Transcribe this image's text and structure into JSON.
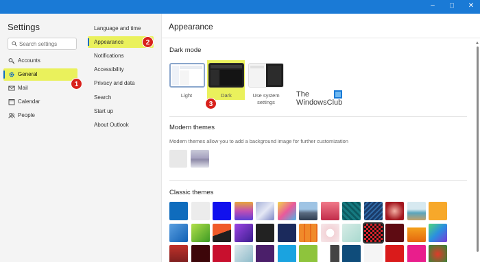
{
  "window": {
    "controls": [
      "minimize",
      "maximize",
      "close"
    ],
    "titlebar_color": "#1a7ad6"
  },
  "left_nav": {
    "title": "Settings",
    "search_placeholder": "Search settings",
    "items": [
      {
        "label": "Accounts",
        "icon": "key-icon"
      },
      {
        "label": "General",
        "icon": "gear-icon",
        "active": true
      },
      {
        "label": "Mail",
        "icon": "mail-icon"
      },
      {
        "label": "Calendar",
        "icon": "calendar-icon"
      },
      {
        "label": "People",
        "icon": "people-icon"
      }
    ]
  },
  "sub_nav": {
    "items": [
      {
        "label": "Language and time"
      },
      {
        "label": "Appearance",
        "active": true
      },
      {
        "label": "Notifications"
      },
      {
        "label": "Accessibility"
      },
      {
        "label": "Privacy and data"
      },
      {
        "label": "Search"
      },
      {
        "label": "Start up"
      },
      {
        "label": "About Outlook"
      }
    ]
  },
  "main": {
    "title": "Appearance",
    "dark_mode": {
      "heading": "Dark mode",
      "options": [
        {
          "label": "Light"
        },
        {
          "label": "Dark",
          "selected": true
        },
        {
          "label": "Use system settings"
        }
      ]
    },
    "modern_themes": {
      "heading": "Modern themes",
      "description": "Modern themes allow you to add a background image for further customization"
    },
    "classic_themes": {
      "heading": "Classic themes"
    }
  },
  "watermark": {
    "line1": "The",
    "line2": "WindowsClub"
  },
  "annotations": [
    "1",
    "2",
    "3"
  ],
  "colors": {
    "accent": "#0f6cbd",
    "highlight": "#eaf15c",
    "badge": "#d8211c"
  }
}
